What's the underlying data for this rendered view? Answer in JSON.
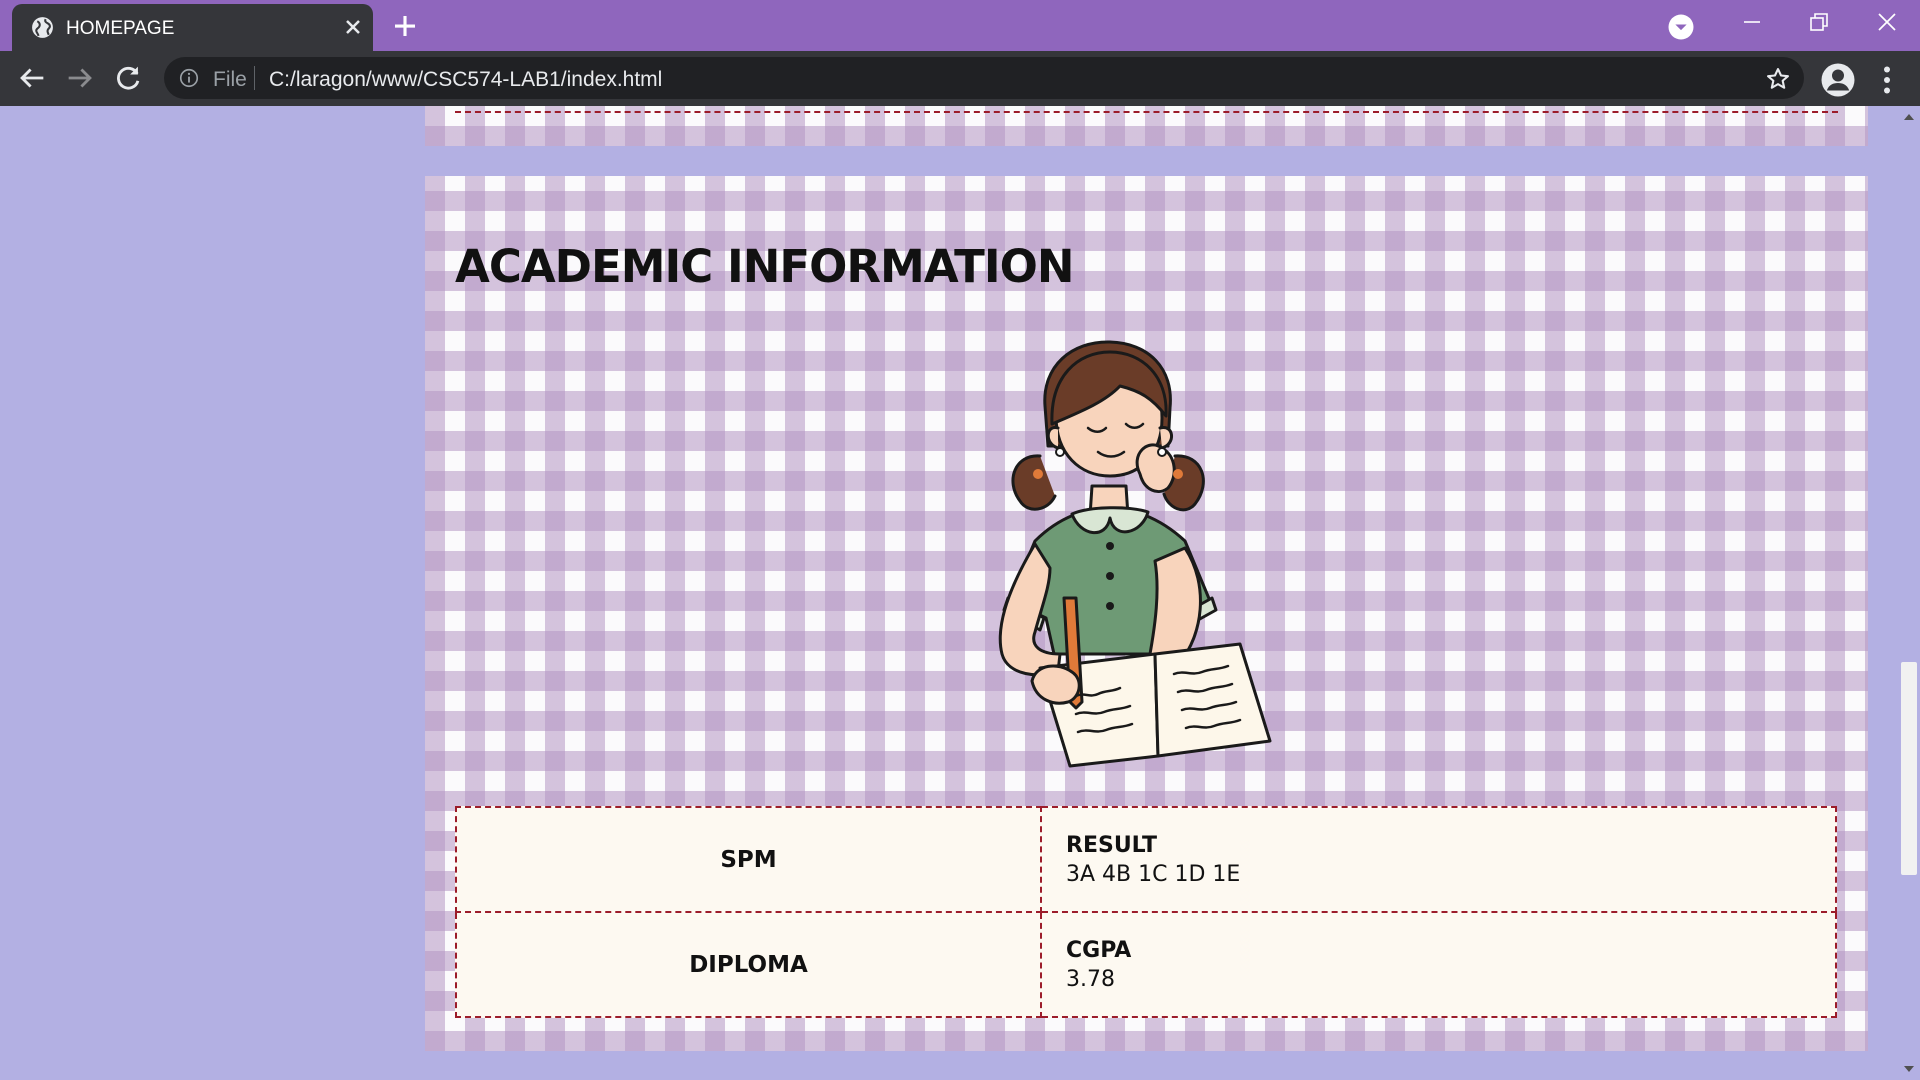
{
  "browser": {
    "tab_title": "HOMEPAGE",
    "scheme_label": "File",
    "url": "C:/laragon/www/CSC574-LAB1/index.html",
    "icons": {
      "favicon": "globe-icon",
      "tab_close": "close-icon",
      "new_tab": "plus-icon",
      "back": "back-arrow-icon",
      "forward": "forward-arrow-icon",
      "reload": "reload-icon",
      "site_info": "info-icon",
      "bookmark": "star-icon",
      "profile": "profile-icon",
      "menu": "kebab-menu-icon"
    },
    "colors": {
      "tab_strip": "#8f66bd",
      "toolbar": "#35363a"
    }
  },
  "page": {
    "section_title": "ACADEMIC INFORMATION",
    "illustration": "girl-studying-illustration",
    "background_color": "#b3b0e3",
    "accent_border_color": "#9c1c2a",
    "rows": [
      {
        "qualification": "SPM",
        "label": "RESULT",
        "value": "3A 4B 1C 1D 1E"
      },
      {
        "qualification": "DIPLOMA",
        "label": "CGPA",
        "value": "3.78"
      }
    ]
  }
}
